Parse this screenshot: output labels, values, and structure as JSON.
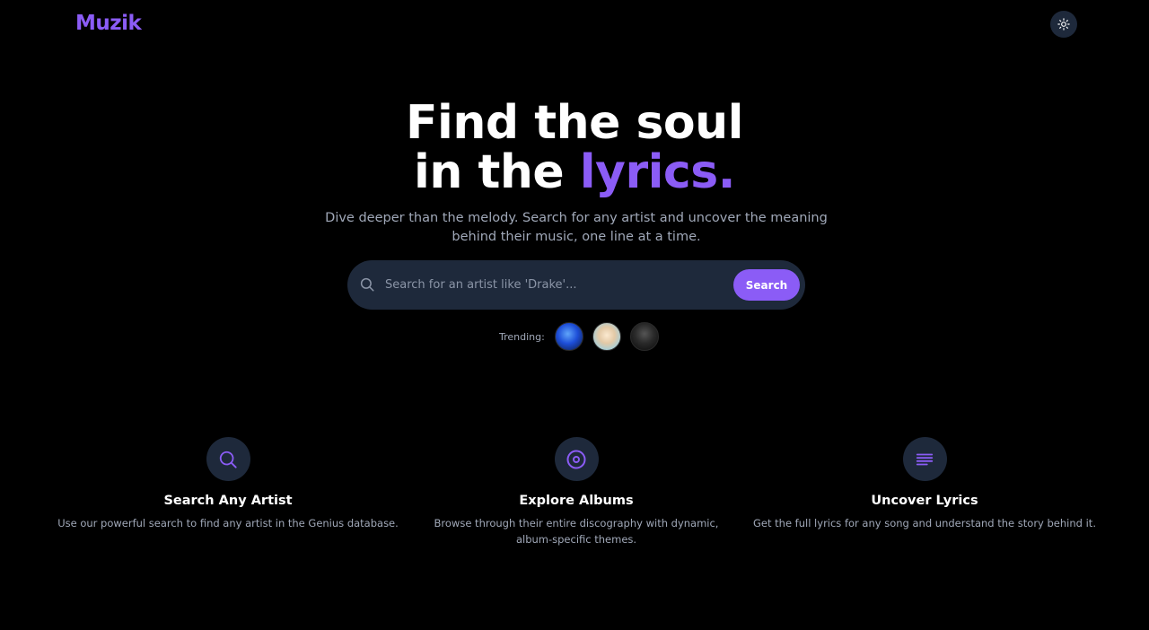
{
  "header": {
    "logo": "Muzik",
    "theme_toggle_icon": "sun-icon"
  },
  "hero": {
    "title_line1": "Find the soul",
    "title_line2_prefix": "in the ",
    "title_line2_accent": "lyrics.",
    "subtitle": "Dive deeper than the melody. Search for any artist and uncover the meaning behind their music, one line at a time."
  },
  "search": {
    "placeholder": "Search for an artist like 'Drake'...",
    "value": "",
    "button_label": "Search",
    "icon": "search-icon"
  },
  "trending": {
    "label": "Trending:",
    "artists": [
      {
        "icon": "artist-avatar"
      },
      {
        "icon": "artist-avatar"
      },
      {
        "icon": "artist-avatar"
      }
    ]
  },
  "features": [
    {
      "icon": "search-icon",
      "title": "Search Any Artist",
      "description": "Use our powerful search to find any artist in the Genius database."
    },
    {
      "icon": "disc-icon",
      "title": "Explore Albums",
      "description": "Browse through their entire discography with dynamic, album-specific themes."
    },
    {
      "icon": "lyrics-lines-icon",
      "title": "Uncover Lyrics",
      "description": "Get the full lyrics for any song and understand the story behind it."
    }
  ],
  "colors": {
    "accent": "#8b5cf6",
    "background": "#000000",
    "surface": "#1e293b",
    "muted_text": "#a0a8b8"
  }
}
